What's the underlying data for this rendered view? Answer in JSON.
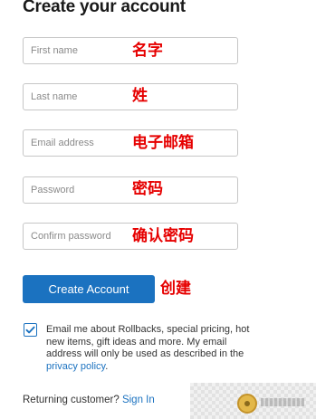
{
  "form": {
    "title": "Create your account",
    "fields": [
      {
        "name": "first-name",
        "placeholder": "First name",
        "value": "",
        "annotation": "名字"
      },
      {
        "name": "last-name",
        "placeholder": "Last name",
        "value": "",
        "annotation": "姓"
      },
      {
        "name": "email",
        "placeholder": "Email address",
        "value": "",
        "annotation": "电子邮箱"
      },
      {
        "name": "password",
        "placeholder": "Password",
        "value": "",
        "annotation": "密码"
      },
      {
        "name": "confirm-password",
        "placeholder": "Confirm password",
        "value": "",
        "annotation": "确认密码"
      }
    ],
    "submit": {
      "label": "Create Account",
      "annotation": "创建"
    },
    "optin": {
      "checked": true,
      "text_before_link": "Email me about Rollbacks, special pricing, hot new items, gift ideas and more. My email address will only be used as described in the",
      "link_text": "privacy policy",
      "text_after_link": "."
    },
    "returning": {
      "prompt": "Returning customer?",
      "link_text": "Sign In"
    }
  },
  "colors": {
    "primary": "#1b72c0",
    "annotation": "#e60000",
    "border": "#c6c6c6",
    "placeholder": "#8a8a8a"
  },
  "icons": {
    "checkbox": "checkmark-icon"
  }
}
